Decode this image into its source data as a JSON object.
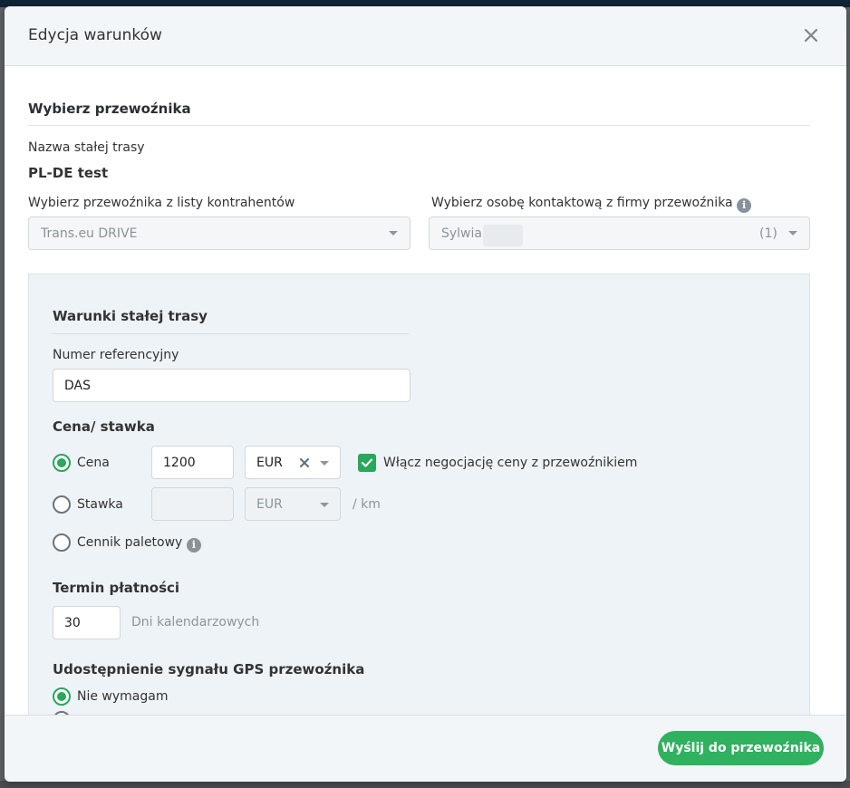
{
  "modal": {
    "title": "Edycja warunków"
  },
  "carrier": {
    "section_heading": "Wybierz przewoźnika",
    "route_name_label": "Nazwa stałej trasy",
    "route_name_value": "PL-DE test",
    "contractor_label": "Wybierz przewoźnika z listy kontrahentów",
    "contractor_value": "Trans.eu DRIVE",
    "contact_label": "Wybierz osobę kontaktową z firmy przewoźnika",
    "contact_value": "Sylwia",
    "contact_count": "(1)"
  },
  "conditions": {
    "heading": "Warunki stałej trasy",
    "reference_label": "Numer referencyjny",
    "reference_value": "DAS",
    "price_heading": "Cena/ stawka",
    "price_option_label": "Cena",
    "price_value": "1200",
    "price_currency": "EUR",
    "negotiation_label": "Włącz negocjację ceny z przewoźnikiem",
    "negotiation_checked": true,
    "rate_option_label": "Stawka",
    "rate_value": "",
    "rate_currency": "EUR",
    "rate_unit": "/ km",
    "pallet_option_label": "Cennik paletowy",
    "payment_heading": "Termin płatności",
    "payment_value": "30",
    "payment_unit": "Dni kalendarzowych",
    "gps_heading": "Udostępnienie sygnału GPS przewoźnika",
    "gps_option_1": "Nie wymagam"
  },
  "footer": {
    "send_label": "Wyślij do przewoźnika"
  },
  "icons": {
    "close": "close-icon",
    "info": "info-icon",
    "caret": "chevron-down-icon",
    "clear": "clear-icon",
    "check": "check-icon"
  },
  "colors": {
    "accent": "#2fb15f",
    "radio_selected": "#27a85a",
    "header_bg": "#f3f6f8",
    "panel_bg": "#eef3f7"
  }
}
